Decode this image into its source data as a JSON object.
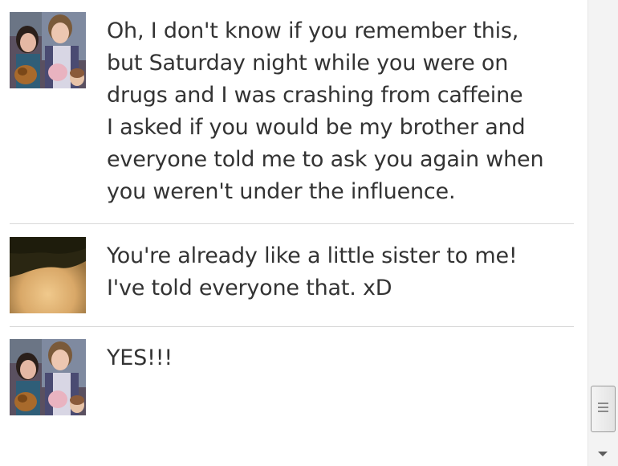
{
  "messages": [
    {
      "avatar": "two-girls-profile-photo",
      "text": "Oh, I don't know if you remember this,\nbut Saturday night while you were on\ndrugs and I was crashing from caffeine\nI asked if you would be my brother and\neveryone told me to ask you again when\nyou weren't under the influence."
    },
    {
      "avatar": "blurry-head-profile-photo",
      "text": "You're already like a little sister to me!\nI've told everyone that. xD"
    },
    {
      "avatar": "two-girls-profile-photo",
      "text": "YES!!!"
    }
  ],
  "scrollbar": {
    "thumb_icon": "grip-icon",
    "down_icon": "chevron-down-icon",
    "scroll_position": 0.95
  }
}
